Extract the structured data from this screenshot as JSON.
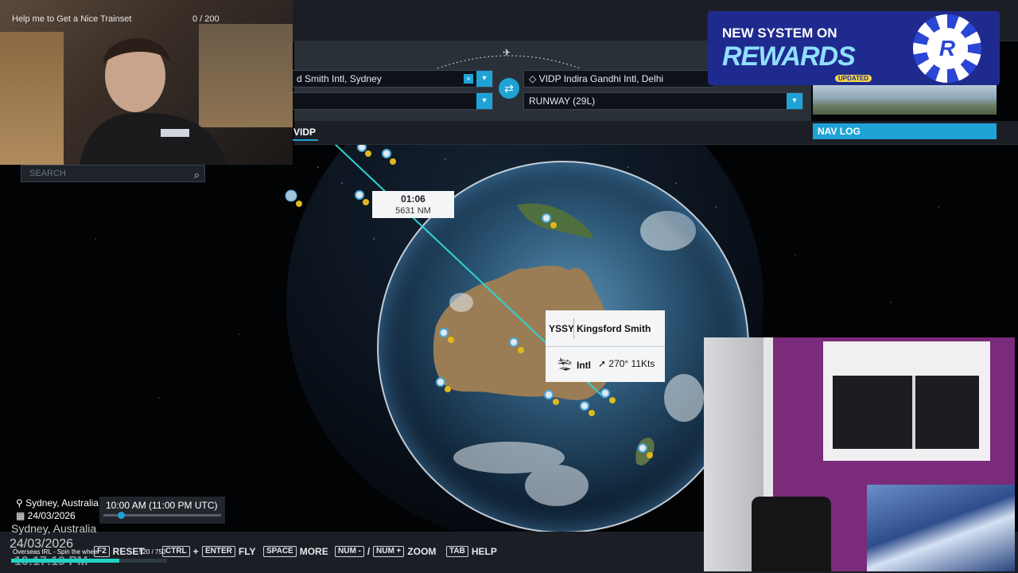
{
  "flight_planner": {
    "departure_text": "d Smith Intl, Sydney",
    "departure_runway_text": "",
    "arrival_text": "VIDP Indira Gandhi Intl, Delhi",
    "arrival_runway_text": "RUNWAY (29L)",
    "active_tab": "VIDP",
    "nav_log_label": "NAV LOG",
    "search_placeholder": "SEARCH"
  },
  "map": {
    "leg_time": "01:06",
    "leg_distance": "5631 NM",
    "airport_card": {
      "icao": "YSSY",
      "name": "Kingsford Smith Intl",
      "wind": "270° 11Kts"
    }
  },
  "keybinds": [
    {
      "key": "F2",
      "label": "RESET"
    },
    {
      "key": "CTRL",
      "label": ""
    },
    {
      "key": "ENTER",
      "label": "FLY"
    },
    {
      "key": "SPACE",
      "label": "MORE"
    },
    {
      "key": "NUM -",
      "label": ""
    },
    {
      "key": "NUM +",
      "label": "ZOOM"
    },
    {
      "key": "TAB",
      "label": "HELP"
    }
  ],
  "keybind_text": {
    "plus": "+",
    "slash": "/"
  },
  "sim_time": {
    "location": "Sydney, Australia",
    "date": "24/03/2026",
    "time": "10:00 AM (11:00 PM UTC)"
  },
  "stream_overlay": {
    "webcam_title": "Help me to Get a Nice Trainset",
    "webcam_count": "0 / 200",
    "overlay_city": "Sydney, Australia",
    "overlay_date": "24/03/2026",
    "overlay_time": "10:17:19 PM",
    "spin_label": "Overseas IRL - Spin the wheel",
    "spin_count": "520 / 750",
    "spin_progress": 0.6933
  },
  "promo": {
    "line1": "NEW SYSTEM ON",
    "line2": "REWARDS",
    "tag": "UPDATED",
    "chip_letter": "R"
  },
  "colors": {
    "accent": "#1fa3d6",
    "route": "#2fd3d0",
    "card_bg": "#f4f5f6"
  },
  "icons": {
    "search": "magnifier-icon",
    "swap": "swap-arrows-icon",
    "dropdown": "chevron-down-icon",
    "location": "map-pin-icon",
    "calendar": "calendar-icon",
    "landing": "plane-landing-icon",
    "wind": "wind-arrow-icon"
  }
}
